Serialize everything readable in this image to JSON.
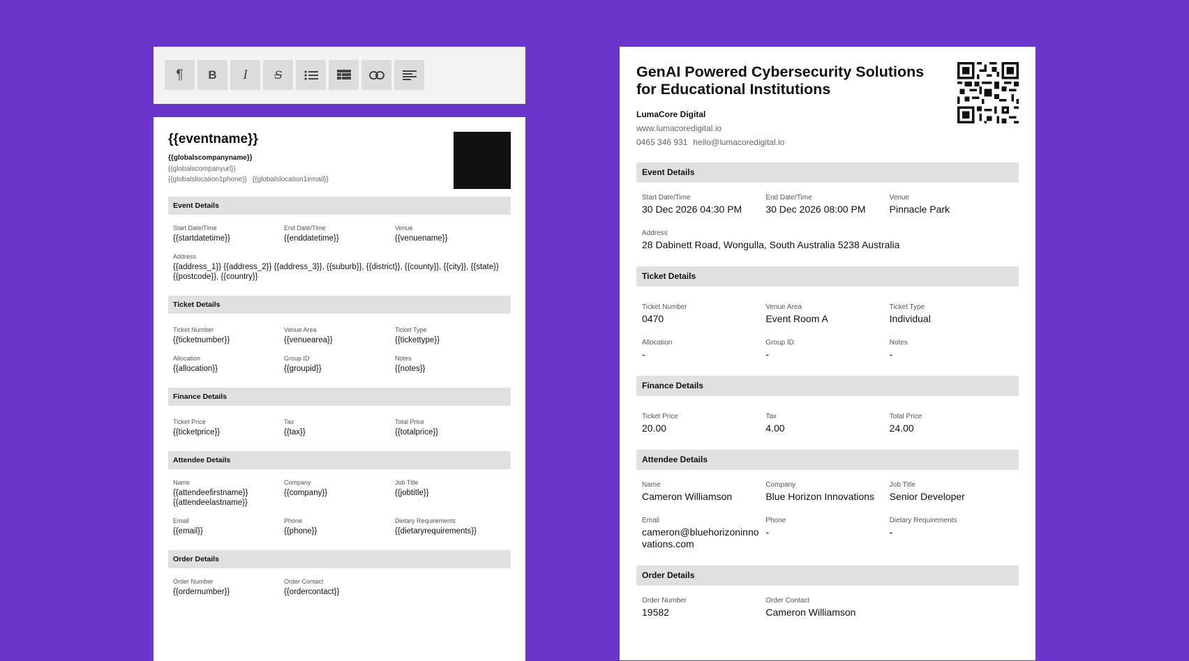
{
  "toolbar": {
    "buttons": [
      {
        "name": "paragraph-icon",
        "glyph": "¶"
      },
      {
        "name": "bold-icon",
        "glyph": "B"
      },
      {
        "name": "italic-icon",
        "glyph": "I"
      },
      {
        "name": "strikethrough-icon",
        "glyph": "S"
      },
      {
        "name": "bulleted-list-icon",
        "glyph": ""
      },
      {
        "name": "table-icon",
        "glyph": ""
      },
      {
        "name": "link-icon",
        "glyph": ""
      },
      {
        "name": "align-left-icon",
        "glyph": ""
      }
    ]
  },
  "template": {
    "title": "{{eventname}}",
    "company": "{{globalscompanyname}}",
    "url": "{{globalscompanyurl}}",
    "phone": "{{globalslocation1phone}}",
    "email": "{{globalslocation1email}}",
    "event": {
      "heading": "Event Details",
      "start_label": "Start Date/Time",
      "start": "{{startdatetime}}",
      "end_label": "End Date/Time",
      "end": "{{enddatetime}}",
      "venue_label": "Venue",
      "venue": "{{venuename}}",
      "address_label": "Address",
      "address": "{{address_1}} {{address_2}} {{address_3}}, {{suburb}}, {{district}}, {{county}}, {{city}}, {{state}} {{postcode}}, {{country}}"
    },
    "ticket": {
      "heading": "Ticket Details",
      "number_label": "Ticket Number",
      "number": "{{ticketnumber}}",
      "area_label": "Venue Area",
      "area": "{{venuearea}}",
      "type_label": "Ticket Type",
      "type": "{{tickettype}}",
      "allocation_label": "Allocation",
      "allocation": "{{allocation}}",
      "group_label": "Group ID",
      "group": "{{groupid}}",
      "notes_label": "Notes",
      "notes": "{{notes}}"
    },
    "finance": {
      "heading": "Finance Details",
      "price_label": "Ticket Price",
      "price": "{{ticketprice}}",
      "tax_label": "Tax",
      "tax": "{{tax}}",
      "total_label": "Total Price",
      "total": "{{totalprice}}"
    },
    "attendee": {
      "heading": "Attendee Details",
      "name_label": "Name",
      "name": "{{attendeefirstname}} {{attendeelastname}}",
      "company_label": "Company",
      "company": "{{company}}",
      "job_label": "Job Title",
      "job": "{{jobtitle}}",
      "email_label": "Email",
      "email": "{{email}}",
      "phone_label": "Phone",
      "phone": "{{phone}}",
      "dietary_label": "Dietary Requirements",
      "dietary": "{{dietaryrequirements}}"
    },
    "order": {
      "heading": "Order Details",
      "number_label": "Order Number",
      "number": "{{ordernumber}}",
      "contact_label": "Order Contact",
      "contact": "{{ordercontact}}"
    }
  },
  "preview": {
    "title": "GenAI Powered Cybersecurity Solutions for Educational Institutions",
    "company": "LumaCore Digital",
    "url": "www.lumacoredigital.io",
    "phone": "0465 346 931",
    "email": "hello@lumacoredigital.io",
    "event": {
      "heading": "Event Details",
      "start_label": "Start Date/Time",
      "start": "30 Dec 2026 04:30 PM",
      "end_label": "End Date/Time",
      "end": "30 Dec 2026 08:00 PM",
      "venue_label": "Venue",
      "venue": "Pinnacle Park",
      "address_label": "Address",
      "address": "28 Dabinett Road, Wongulla, South Australia 5238 Australia"
    },
    "ticket": {
      "heading": "Ticket Details",
      "number_label": "Ticket Number",
      "number": "0470",
      "area_label": "Venue Area",
      "area": "Event Room A",
      "type_label": "Ticket Type",
      "type": "Individual",
      "allocation_label": "Allocation",
      "allocation": "-",
      "group_label": "Group ID",
      "group": "-",
      "notes_label": "Notes",
      "notes": "-"
    },
    "finance": {
      "heading": "Finance Details",
      "price_label": "Ticket Price",
      "price": "20.00",
      "tax_label": "Tax",
      "tax": "4.00",
      "total_label": "Total Price",
      "total": "24.00"
    },
    "attendee": {
      "heading": "Attendee Details",
      "name_label": "Name",
      "name": "Cameron Williamson",
      "company_label": "Company",
      "company": "Blue Horizon Innovations",
      "job_label": "Job Title",
      "job": "Senior Developer",
      "email_label": "Email",
      "email": "cameron@bluehorizoninnovations.com",
      "phone_label": "Phone",
      "phone": "-",
      "dietary_label": "Dietary Requirements",
      "dietary": "-"
    },
    "order": {
      "heading": "Order Details",
      "number_label": "Order Number",
      "number": "19582",
      "contact_label": "Order Contact",
      "contact": "Cameron Williamson"
    }
  },
  "colors": {
    "background": "#6a35cb",
    "section_bar": "#e0e0e0",
    "toolbar_bg": "#f3f3f3",
    "toolbar_button": "#dcdcdc"
  }
}
